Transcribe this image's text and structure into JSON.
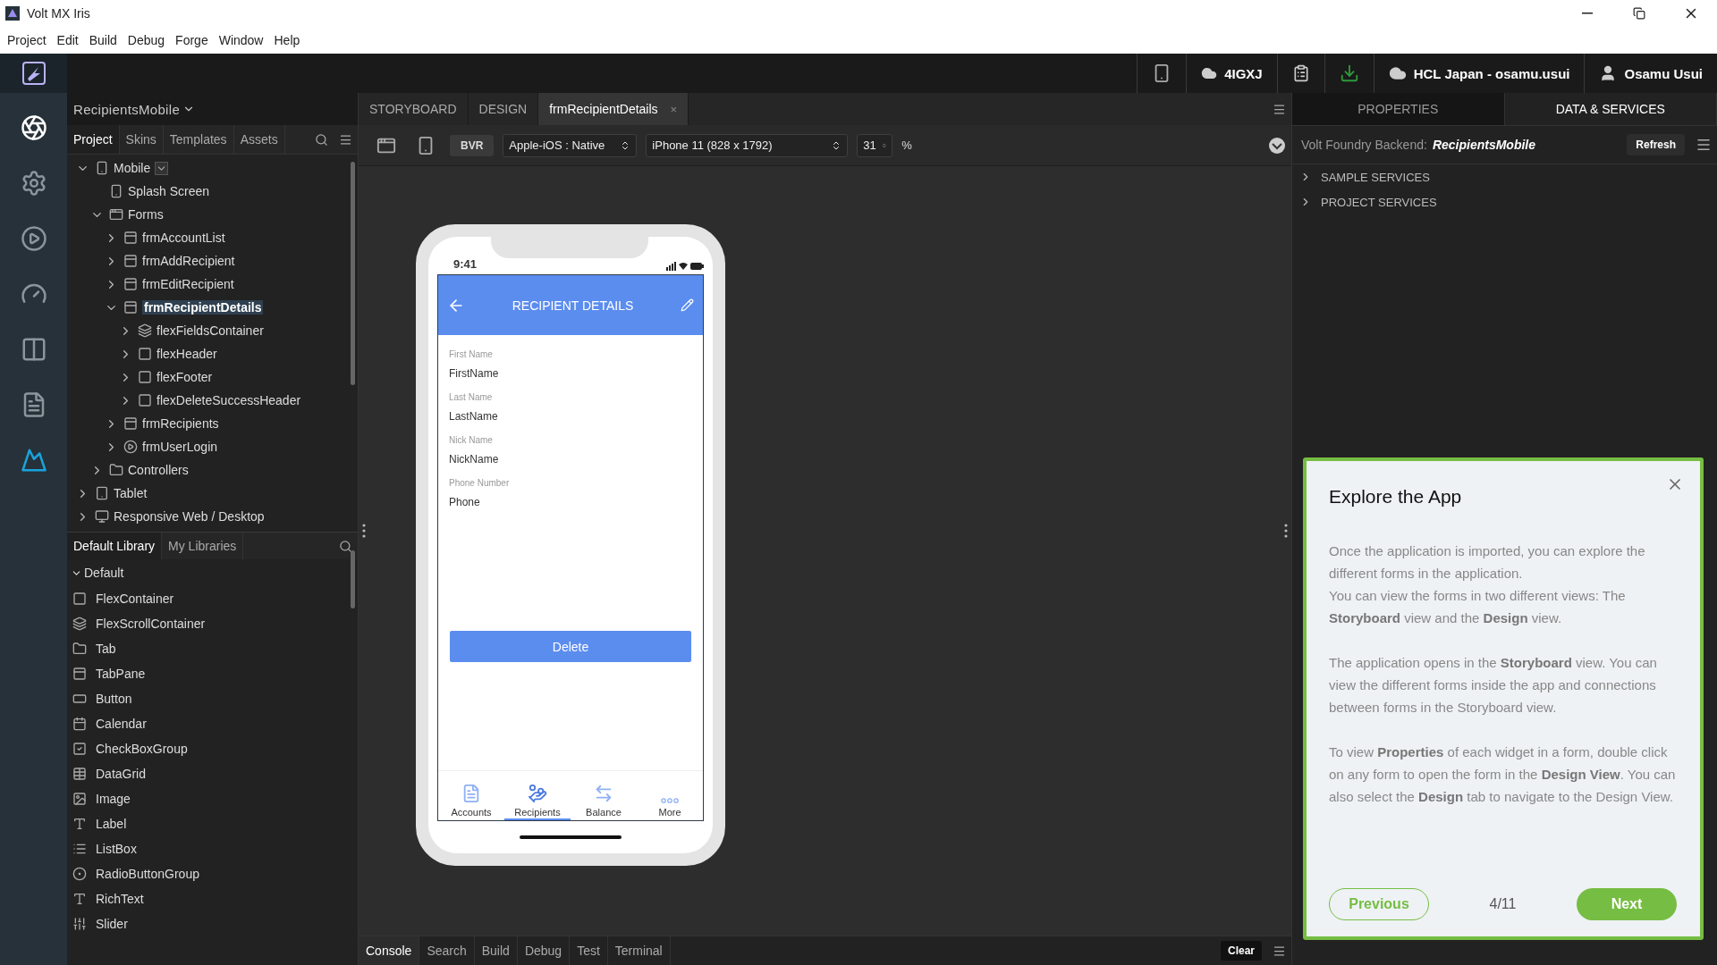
{
  "window": {
    "title": "Volt MX Iris"
  },
  "menu": [
    "Project",
    "Edit",
    "Build",
    "Debug",
    "Forge",
    "Window",
    "Help"
  ],
  "rail": [
    {
      "kind": "aperture",
      "selected": true
    },
    {
      "kind": "gear",
      "selected": false
    },
    {
      "kind": "play",
      "selected": false
    },
    {
      "kind": "gauge",
      "selected": false
    },
    {
      "kind": "split",
      "selected": false
    },
    {
      "kind": "doc",
      "selected": false
    },
    {
      "kind": "peaks",
      "selected": false
    }
  ],
  "topbar": {
    "account_id": "4IGXJ",
    "org": "HCL Japan - osamu.usui",
    "user": "Osamu Usui"
  },
  "left_panel": {
    "project": "RecipientsMobile",
    "tabs": [
      {
        "label": "Project",
        "selected": true
      },
      {
        "label": "Skins",
        "selected": false
      },
      {
        "label": "Templates",
        "selected": false
      },
      {
        "label": "Assets",
        "selected": false
      }
    ],
    "tree": [
      {
        "label": "Mobile",
        "kind": "phone",
        "expanded": true,
        "selected": false,
        "dropdown": true,
        "children": [
          {
            "label": "Splash Screen",
            "kind": "splash",
            "selected": false
          },
          {
            "label": "Forms",
            "kind": "forms",
            "expanded": true,
            "selected": false,
            "children": [
              {
                "label": "frmAccountList",
                "kind": "form",
                "expanded": false,
                "selected": false
              },
              {
                "label": "frmAddRecipient",
                "kind": "form",
                "expanded": false,
                "selected": false
              },
              {
                "label": "frmEditRecipient",
                "kind": "form",
                "expanded": false,
                "selected": false
              },
              {
                "label": "frmRecipientDetails",
                "kind": "form",
                "expanded": true,
                "selected": true,
                "children": [
                  {
                    "label": "flexFieldsContainer",
                    "kind": "scroll",
                    "expanded": false,
                    "selected": false
                  },
                  {
                    "label": "flexHeader",
                    "kind": "flex",
                    "expanded": false,
                    "selected": false
                  },
                  {
                    "label": "flexFooter",
                    "kind": "flex",
                    "expanded": false,
                    "selected": false
                  },
                  {
                    "label": "flexDeleteSuccessHeader",
                    "kind": "flex",
                    "expanded": false,
                    "selected": false
                  }
                ]
              },
              {
                "label": "frmRecipients",
                "kind": "form",
                "expanded": false,
                "selected": false
              },
              {
                "label": "frmUserLogin",
                "kind": "login",
                "expanded": false,
                "selected": false
              }
            ]
          },
          {
            "label": "Controllers",
            "kind": "folder",
            "expanded": false,
            "selected": false
          }
        ]
      },
      {
        "label": "Tablet",
        "kind": "tablet",
        "expanded": false,
        "selected": false
      },
      {
        "label": "Responsive Web / Desktop",
        "kind": "desktop",
        "expanded": false,
        "selected": false
      }
    ]
  },
  "library": {
    "tabs": [
      {
        "label": "Default Library",
        "selected": true
      },
      {
        "label": "My Libraries",
        "selected": false
      }
    ],
    "group": "Default",
    "items": [
      {
        "kind": "flex",
        "label": "FlexContainer"
      },
      {
        "kind": "scroll",
        "label": "FlexScrollContainer"
      },
      {
        "kind": "tab",
        "label": "Tab"
      },
      {
        "kind": "tabpane",
        "label": "TabPane"
      },
      {
        "kind": "button",
        "label": "Button"
      },
      {
        "kind": "calendar",
        "label": "Calendar"
      },
      {
        "kind": "checkbox",
        "label": "CheckBoxGroup"
      },
      {
        "kind": "grid",
        "label": "DataGrid"
      },
      {
        "kind": "image",
        "label": "Image"
      },
      {
        "kind": "label",
        "label": "Label"
      },
      {
        "kind": "listbox",
        "label": "ListBox"
      },
      {
        "kind": "radio",
        "label": "RadioButtonGroup"
      },
      {
        "kind": "richtext",
        "label": "RichText"
      },
      {
        "kind": "slider",
        "label": "Slider"
      }
    ]
  },
  "editor": {
    "tabs": [
      {
        "label": "STORYBOARD",
        "selected": false
      },
      {
        "label": "DESIGN",
        "selected": false
      },
      {
        "label": "frmRecipientDetails",
        "selected": true,
        "close": "×"
      }
    ],
    "mode": "BVR",
    "platform": "Apple-iOS : Native",
    "device": "iPhone 11 (828 x 1792)",
    "zoom": "31",
    "zoom_unit": "%"
  },
  "phone": {
    "time": "9:41",
    "title": "RECIPIENT DETAILS",
    "fields": [
      {
        "label": "First Name",
        "value": "FirstName"
      },
      {
        "label": "Last Name",
        "value": "LastName"
      },
      {
        "label": "Nick Name",
        "value": "NickName"
      },
      {
        "label": "Phone Number",
        "value": "Phone"
      }
    ],
    "button": "Delete",
    "nav": [
      {
        "kind": "accounts",
        "label": "Accounts",
        "selected": false
      },
      {
        "kind": "recipients",
        "label": "Recipients",
        "selected": true
      },
      {
        "kind": "balance",
        "label": "Balance",
        "selected": false
      },
      {
        "kind": "more",
        "label": "More",
        "selected": false
      }
    ]
  },
  "right_panel": {
    "tabs": [
      {
        "label": "PROPERTIES",
        "selected": false
      },
      {
        "label": "DATA & SERVICES",
        "selected": true
      }
    ],
    "backend_label": "Volt Foundry Backend:",
    "backend_name": "RecipientsMobile",
    "refresh": "Refresh",
    "services": [
      {
        "label": "SAMPLE SERVICES",
        "expanded": false
      },
      {
        "label": "PROJECT SERVICES",
        "expanded": false
      }
    ]
  },
  "tour": {
    "title": "Explore the App",
    "paragraphs": [
      [
        "Once the application is imported, you can explore the different forms in the application.",
        "You can view the forms in two different views: The **Storyboard** view and the **Design** view."
      ],
      [
        "The application opens in the **Storyboard** view. You can view the different forms inside the app and connections between forms in the Storyboard view."
      ],
      [
        "To view **Properties** of each widget in a form, double click on any form to open the form in the **Design View**. You can also select the **Design** tab to navigate to the Design View."
      ]
    ],
    "previous": "Previous",
    "counter": "4/11",
    "next": "Next"
  },
  "console": {
    "tabs": [
      {
        "label": "Console",
        "selected": true
      },
      {
        "label": "Search",
        "selected": false
      },
      {
        "label": "Build",
        "selected": false
      },
      {
        "label": "Debug",
        "selected": false
      },
      {
        "label": "Test",
        "selected": false
      },
      {
        "label": "Terminal",
        "selected": false
      }
    ],
    "clear": "Clear"
  }
}
